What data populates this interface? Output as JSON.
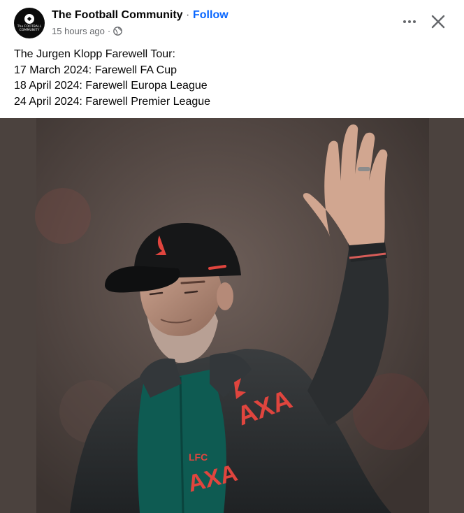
{
  "post": {
    "page_name": "The Football Community",
    "separator": "·",
    "follow_label": "Follow",
    "timestamp": "15 hours ago",
    "meta_separator": "·",
    "privacy_icon": "globe-icon",
    "avatar_text": "The FOOTBALL COMMUNITY",
    "text_lines": [
      "The Jurgen Klopp Farewell Tour:",
      "17 March 2024: Farewell FA Cup",
      "18 April 2024: Farewell Europa League",
      "24 April 2024: Farewell Premier League"
    ],
    "image": {
      "description_icon": "photo-image",
      "sponsor_text": "AXA",
      "badge_text": "LFC"
    }
  },
  "icons": {
    "more": "more-options-icon",
    "close": "close-icon"
  },
  "colors": {
    "follow": "#0866ff",
    "meta": "#65676b",
    "photo_bg": "#4a413d",
    "jacket": "#2a2d2f",
    "shirt": "#0e5b52",
    "logo_red": "#e0453e"
  }
}
